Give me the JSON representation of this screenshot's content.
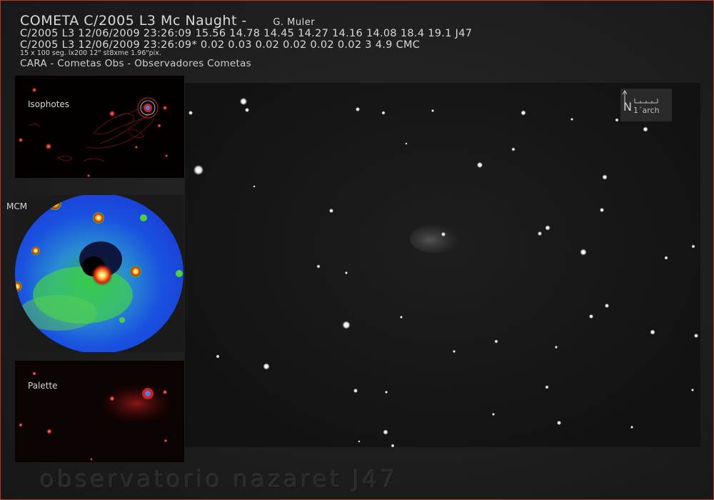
{
  "header": {
    "title": "COMETA C/2005 L3 Mc Naught  -",
    "author": "G. Muler",
    "line2": "C/2005 L3 12/06/2009 23:26:09 15.56 14.78 14.45 14.27 14.16 14.08 18.4 19.1 J47",
    "line3": "C/2005 L3 12/06/2009 23:26:09* 0.02 0.03 0.02 0.02 0.02 0.02 3 4.9 CMC",
    "line4": "15 x 100 seg. lx200 12\" st8xme 1.96\"pix.",
    "line5": "CARA - Cometas Obs - Observadores Cometas"
  },
  "scale_marker": {
    "north": "N",
    "label": "1´arch"
  },
  "panels": {
    "isophotes": "Isophotes",
    "mcm": "MCM",
    "palette": "Palette"
  },
  "footer": "observatorio nazaret J47",
  "colors": {
    "frame_border": "#b33a2a",
    "isophote_red": "#c0282a",
    "mcm_blue": "#1a3fd6",
    "mcm_green": "#2bd13a",
    "palette_red": "#a01010"
  }
}
